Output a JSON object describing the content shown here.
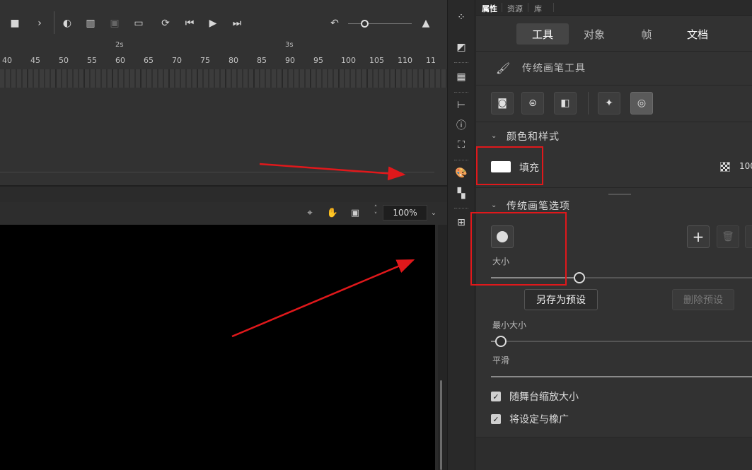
{
  "timeline": {
    "seconds": [
      {
        "label": "2s"
      },
      {
        "label": "3s"
      }
    ],
    "frames": [
      "40",
      "45",
      "50",
      "55",
      "60",
      "65",
      "70",
      "75",
      "80",
      "85",
      "90",
      "95",
      "100",
      "105",
      "110",
      "11"
    ]
  },
  "stage_bar": {
    "zoom": "100%"
  },
  "panel_tabs": {
    "properties": "属性",
    "assets": "资源",
    "library": "库"
  },
  "segments": {
    "tool": "工具",
    "object": "对象",
    "frame": "帧",
    "document": "文档"
  },
  "tool": {
    "title": "传统画笔工具"
  },
  "color_style": {
    "header": "颜色和样式",
    "fill_label": "填充",
    "fill_color": "#ffffff",
    "alpha_value": "100"
  },
  "brush_options": {
    "header": "传统画笔选项",
    "size_label": "大小",
    "save_preset": "另存为预设",
    "delete_preset": "删除预设",
    "min_size_label": "最小大小",
    "smoothing_label": "平滑",
    "scale_with_stage": "随舞台缩放大小",
    "apply_to_eraser": "将设定与橡广"
  },
  "annotations": {
    "highlight_color": "#e0181b"
  }
}
